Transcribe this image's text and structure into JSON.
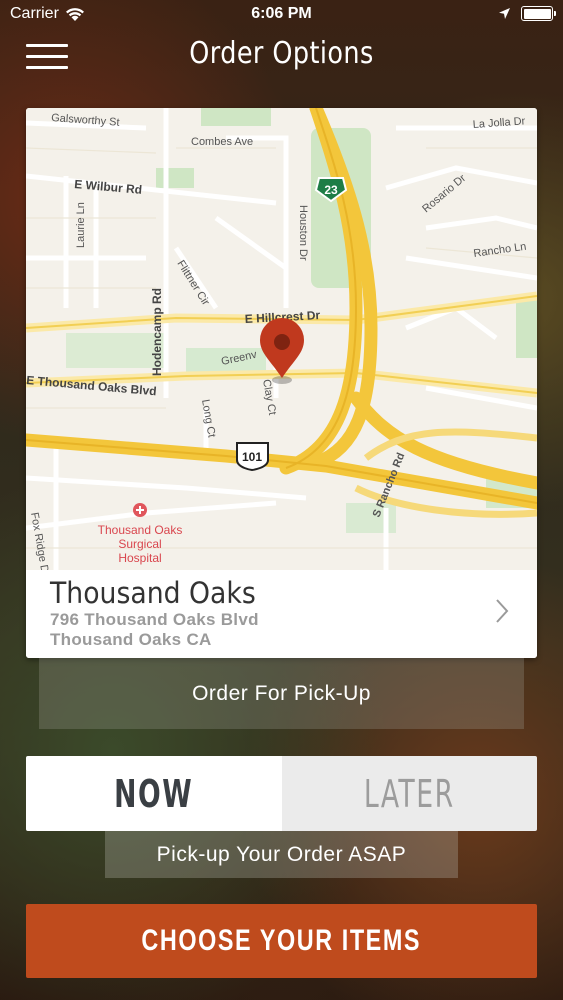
{
  "status_bar": {
    "carrier": "Carrier",
    "time": "6:06 PM",
    "battery_level": 1.0
  },
  "nav": {
    "title": "Order Options",
    "menu_icon": "hamburger-menu-icon"
  },
  "map": {
    "streets": [
      "Galsworthy St",
      "Combes Ave",
      "La Jolla Dr",
      "E Wilbur Rd",
      "Laurie Ln",
      "Houston Dr",
      "Rosario Dr",
      "Rancho Ln",
      "Flittner Cir",
      "Hodencamp Rd",
      "E Hillcrest Dr",
      "Greenv",
      "E Thousand Oaks Blvd",
      "Clay Ct",
      "Long Ct",
      "S Rancho Rd",
      "Fox Ridge D"
    ],
    "shields": {
      "state_route": "23",
      "us_route": "101"
    },
    "poi": {
      "lines": [
        "Thousand Oaks",
        "Surgical",
        "Hospital"
      ],
      "icon": "hospital-cross-icon"
    },
    "pin_icon": "location-pin-icon",
    "pin_color": "#c0391e"
  },
  "store": {
    "name": "Thousand Oaks",
    "address_line1": "796 Thousand Oaks Blvd",
    "address_line2": "Thousand Oaks CA"
  },
  "order_mode": {
    "label": "Order For Pick-Up"
  },
  "timing": {
    "now_label": "NOW",
    "later_label": "LATER",
    "selected": "NOW",
    "note": "Pick-up Your Order ASAP"
  },
  "cta": {
    "label": "CHOOSE YOUR ITEMS",
    "color": "#bf4b1d"
  }
}
